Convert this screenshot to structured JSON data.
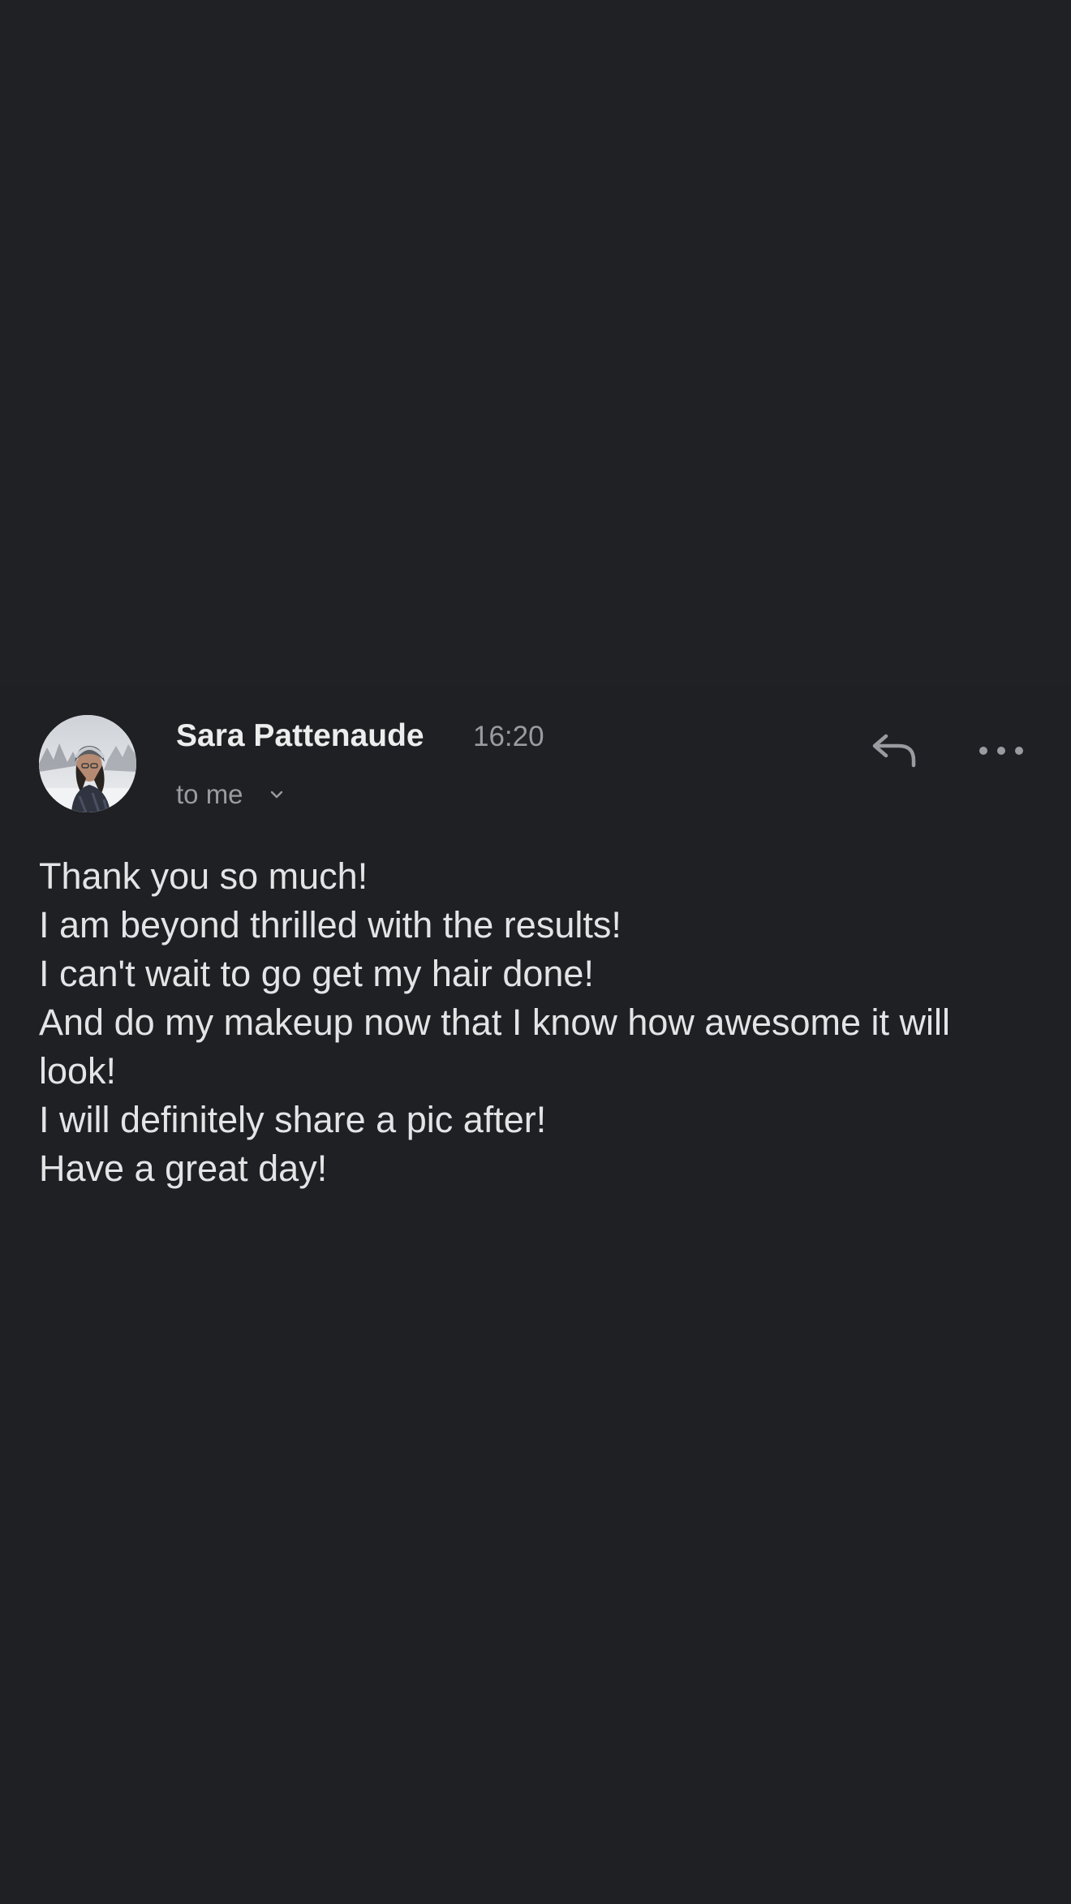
{
  "email": {
    "sender_name": "Sara Pattenaude",
    "time": "16:20",
    "recipient_label": "to me",
    "body_lines": [
      "Thank you so much!",
      "I am beyond thrilled with the results!",
      "I can't wait to go get my hair done!",
      "And do my makeup now that I know how awesome it will look!",
      "I will definitely share a pic after!",
      "Have a great day!"
    ]
  },
  "icons": {
    "avatar": "avatar",
    "reply": "reply-icon",
    "more": "more-horizontal-icon",
    "recipient_expand": "chevron-down-icon"
  },
  "colors": {
    "background": "#1f2023",
    "primary_text": "#ededee",
    "secondary_text": "#9a9ba0",
    "body_text": "#e3e4e6"
  }
}
